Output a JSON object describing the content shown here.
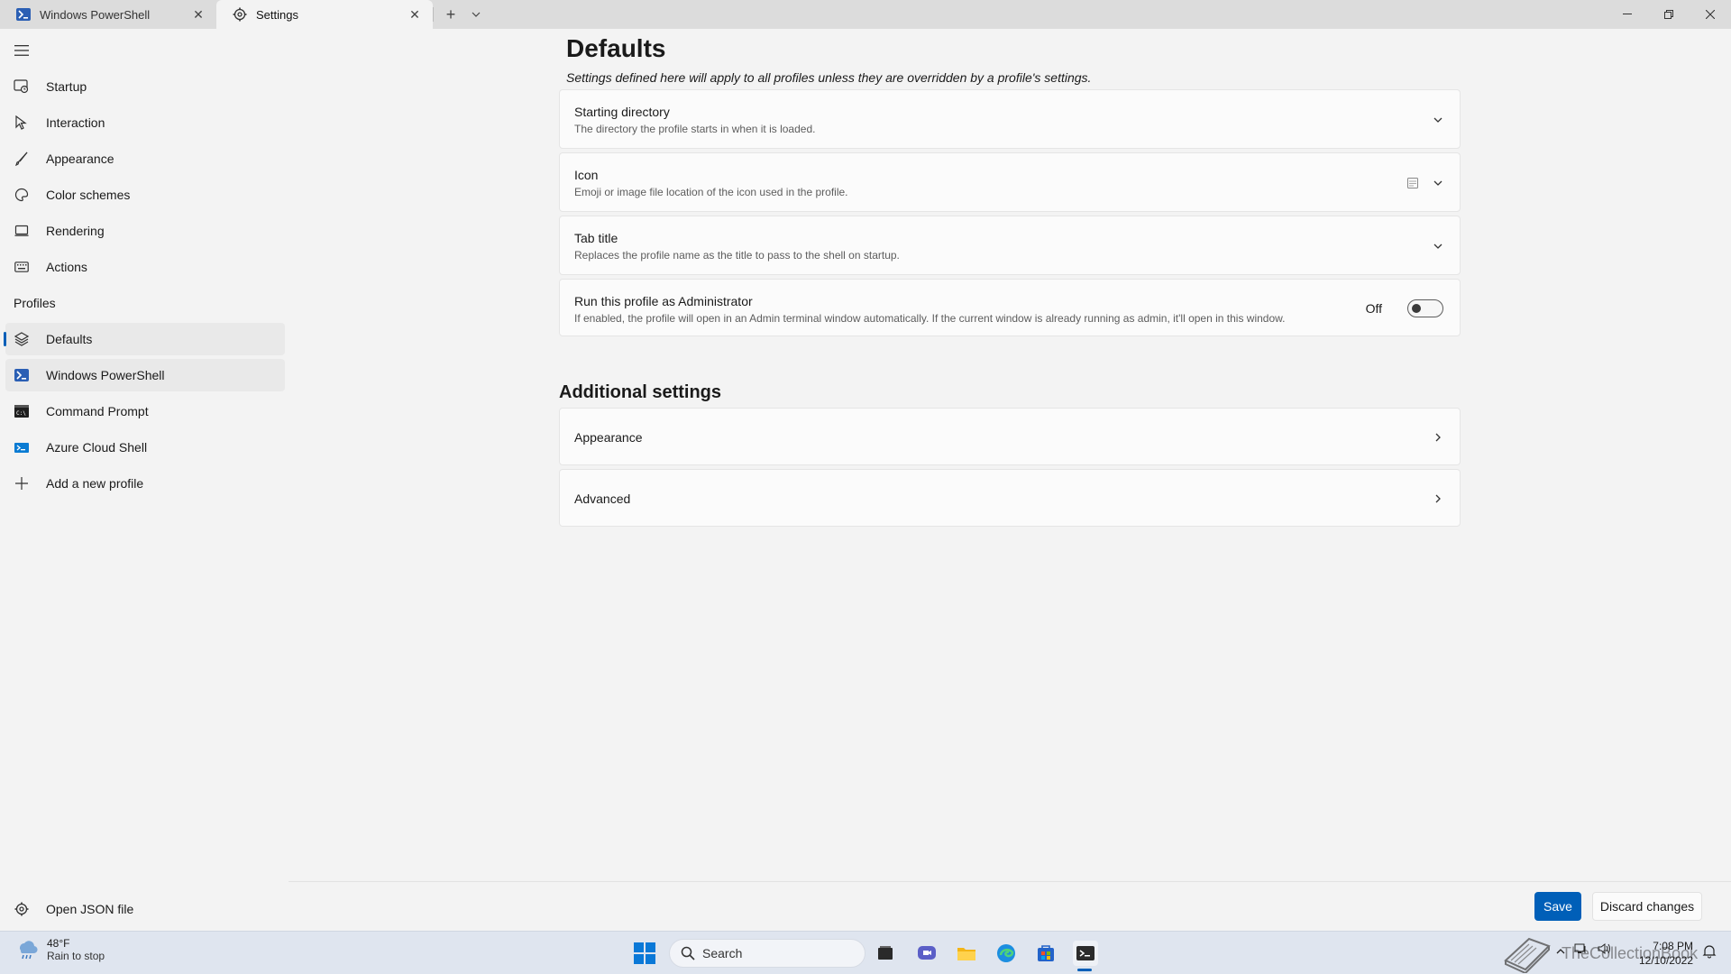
{
  "tabs": [
    {
      "label": "Windows PowerShell",
      "icon": "powershell-icon"
    },
    {
      "label": "Settings",
      "icon": "gear-icon"
    }
  ],
  "sidebar": {
    "items": [
      {
        "label": "Startup",
        "icon": "startup-icon"
      },
      {
        "label": "Interaction",
        "icon": "cursor-icon"
      },
      {
        "label": "Appearance",
        "icon": "brush-icon"
      },
      {
        "label": "Color schemes",
        "icon": "palette-icon"
      },
      {
        "label": "Rendering",
        "icon": "monitor-icon"
      },
      {
        "label": "Actions",
        "icon": "keyboard-icon"
      }
    ],
    "profiles_header": "Profiles",
    "profiles": [
      {
        "label": "Defaults",
        "icon": "layers-icon"
      },
      {
        "label": "Windows PowerShell",
        "icon": "powershell-icon"
      },
      {
        "label": "Command Prompt",
        "icon": "cmd-icon"
      },
      {
        "label": "Azure Cloud Shell",
        "icon": "azure-icon"
      },
      {
        "label": "Add a new profile",
        "icon": "plus-icon"
      }
    ],
    "open_json": "Open JSON file"
  },
  "main": {
    "title": "Defaults",
    "subtitle": "Settings defined here will apply to all profiles unless they are overridden by a profile's settings.",
    "settings": [
      {
        "title": "Starting directory",
        "desc": "The directory the profile starts in when it is loaded."
      },
      {
        "title": "Icon",
        "desc": "Emoji or image file location of the icon used in the profile."
      },
      {
        "title": "Tab title",
        "desc": "Replaces the profile name as the title to pass to the shell on startup."
      },
      {
        "title": "Run this profile as Administrator",
        "desc": "If enabled, the profile will open in an Admin terminal window automatically. If the current window is already running as admin, it'll open in this window.",
        "toggle_label": "Off",
        "toggle_on": false
      }
    ],
    "additional_title": "Additional settings",
    "additional": [
      {
        "title": "Appearance"
      },
      {
        "title": "Advanced"
      }
    ]
  },
  "footer": {
    "save_label": "Save",
    "discard_label": "Discard changes"
  },
  "taskbar": {
    "weather_temp": "48°F",
    "weather_cond": "Rain to stop",
    "search_placeholder": "Search",
    "time": "7:08 PM",
    "date": "12/10/2022",
    "watermark": "TheCollectionBook"
  },
  "colors": {
    "accent": "#005fb8",
    "background": "#f3f3f3",
    "card": "#fbfbfb"
  }
}
